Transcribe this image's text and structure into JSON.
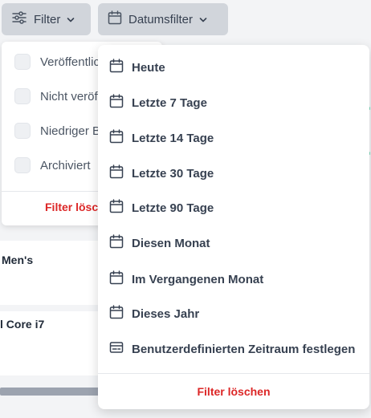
{
  "colors": {
    "button_bg": "#d1d5db",
    "clear_red": "#dc2626",
    "accent_green": "#10b981"
  },
  "toolbar": {
    "filter_label": "Filter",
    "date_filter_label": "Datumsfilter"
  },
  "status_filter": {
    "items": [
      {
        "label": "Veröffentlicht",
        "checked": false
      },
      {
        "label": "Nicht veröffentlicht",
        "checked": false
      },
      {
        "label": "Niedriger Bestand",
        "checked": false
      },
      {
        "label": "Archiviert",
        "checked": false
      }
    ],
    "clear_label": "Filter löschen"
  },
  "date_filter": {
    "options": [
      {
        "label": "Heute",
        "icon": "calendar-icon"
      },
      {
        "label": "Letzte 7 Tage",
        "icon": "calendar-icon"
      },
      {
        "label": "Letzte 14 Tage",
        "icon": "calendar-icon"
      },
      {
        "label": "Letzte 30 Tage",
        "icon": "calendar-icon"
      },
      {
        "label": "Letzte 90 Tage",
        "icon": "calendar-icon"
      },
      {
        "label": "Diesen Monat",
        "icon": "calendar-icon"
      },
      {
        "label": "Im Vergangenen Monat",
        "icon": "calendar-icon"
      },
      {
        "label": "Dieses Jahr",
        "icon": "calendar-icon"
      },
      {
        "label": "Benutzerdefinierten Zeitraum festlegen",
        "icon": "custom-range-icon"
      }
    ],
    "clear_label": "Filter löschen"
  },
  "background_rows": [
    {
      "name": "Men's"
    },
    {
      "name": "l Core i7"
    }
  ]
}
